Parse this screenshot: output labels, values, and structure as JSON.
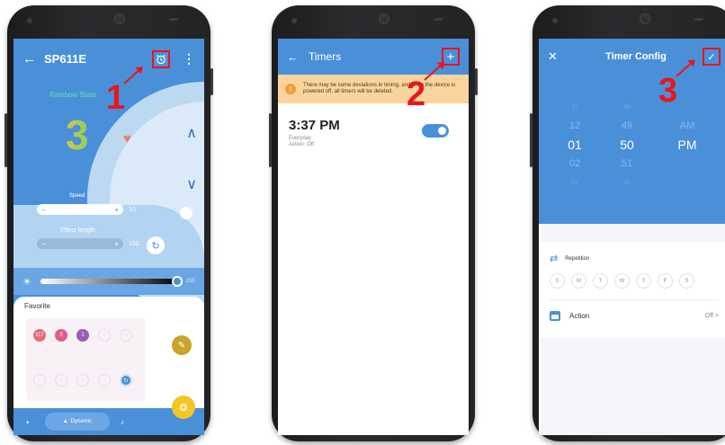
{
  "screen1": {
    "title": "SP611E",
    "back_icon": "←",
    "more_icon": "⋮",
    "scene_name": "Rainbow Stars",
    "scene_number": "3",
    "speed_label": "Speed",
    "speed_value": "10",
    "effect_length_label": "Effect length",
    "effect_length_value": "150",
    "brightness_value": "255",
    "favorite_title": "Favorite",
    "favorites": [
      "117",
      "3",
      "1"
    ],
    "dynamic_tab": "Dynamic",
    "minus": "−",
    "plus": "+"
  },
  "screen2": {
    "title": "Timers",
    "back_icon": "←",
    "add_icon": "+",
    "warning": "There may be some deviations in timing, and once the device is powered off, all timers will be deleted.",
    "timer": {
      "time": "3:37 PM",
      "repeat": "Everyday",
      "action": "Action: Off",
      "enabled": true
    }
  },
  "screen3": {
    "title": "Timer Config",
    "close_icon": "✕",
    "confirm_icon": "✓",
    "hours": [
      "11",
      "12",
      "01",
      "02",
      "03"
    ],
    "minutes": [
      "48",
      "49",
      "50",
      "51",
      "52"
    ],
    "periods": [
      "",
      "AM",
      "PM",
      "",
      ""
    ],
    "repetition_label": "Repetition",
    "days": [
      "S",
      "M",
      "T",
      "W",
      "T",
      "F",
      "S"
    ],
    "action_label": "Action",
    "action_value": "Off >"
  },
  "annotations": {
    "step1": "1",
    "step2": "2",
    "step3": "3",
    "color": "#e8161b"
  },
  "colors": {
    "primary": "#4a90d9",
    "warning_bg": "#fbd49d",
    "accent_yellow": "#f3c623"
  }
}
